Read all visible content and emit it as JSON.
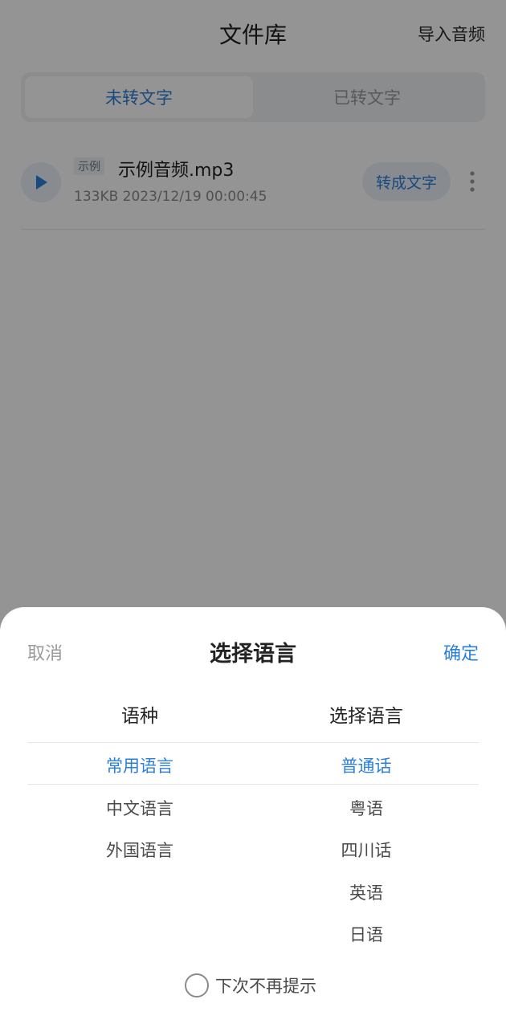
{
  "header": {
    "title": "文件库",
    "import_label": "导入音频"
  },
  "tabs": [
    {
      "label": "未转文字",
      "active": true
    },
    {
      "label": "已转文字",
      "active": false
    }
  ],
  "files": [
    {
      "badge": "示例",
      "name": "示例音频.mp3",
      "meta": "133KB 2023/12/19 00:00:45",
      "action_label": "转成文字"
    }
  ],
  "sheet": {
    "cancel_label": "取消",
    "title": "选择语言",
    "confirm_label": "确定",
    "left_header": "语种",
    "right_header": "选择语言",
    "left_options": [
      "常用语言",
      "中文语言",
      "外国语言"
    ],
    "left_selected": "常用语言",
    "right_options": [
      "普通话",
      "粤语",
      "四川话",
      "英语",
      "日语"
    ],
    "right_selected": "普通话",
    "no_remind_label": "下次不再提示",
    "no_remind_checked": false
  },
  "colors": {
    "accent": "#2b7fd9",
    "overlay": "rgba(0,0,0,0.42)"
  },
  "icons": [
    "play-icon",
    "more-vertical-icon",
    "radio-unchecked-icon"
  ]
}
